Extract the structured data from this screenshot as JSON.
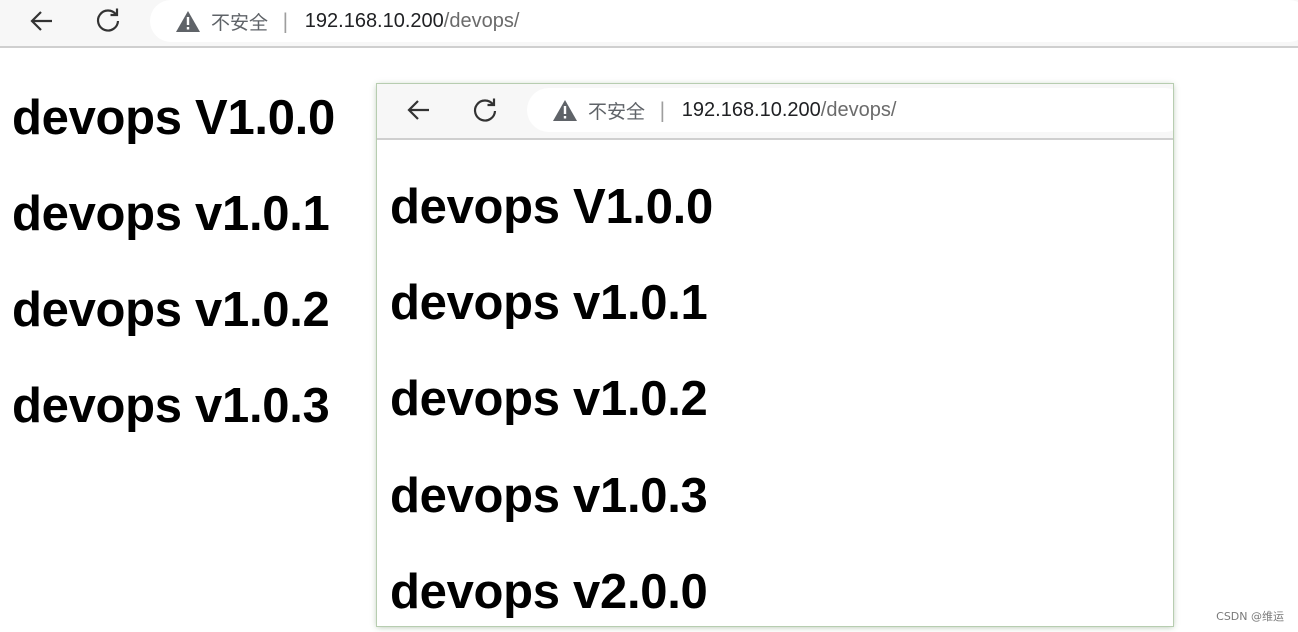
{
  "browser": {
    "security_label": "不安全",
    "separator": "|",
    "url_host": "192.168.10.200",
    "url_path": "/devops/"
  },
  "page": {
    "headings": [
      "devops V1.0.0",
      "devops v1.0.1",
      "devops v1.0.2",
      "devops v1.0.3"
    ]
  },
  "inset": {
    "browser": {
      "security_label": "不安全",
      "separator": "|",
      "url_host": "192.168.10.200",
      "url_path": "/devops/"
    },
    "page": {
      "headings": [
        "devops V1.0.0",
        "devops v1.0.1",
        "devops v1.0.2",
        "devops v1.0.3",
        "devops v2.0.0"
      ]
    }
  },
  "watermark": "CSDN @维运",
  "icons": [
    "back-arrow-icon",
    "reload-icon",
    "warning-icon"
  ]
}
